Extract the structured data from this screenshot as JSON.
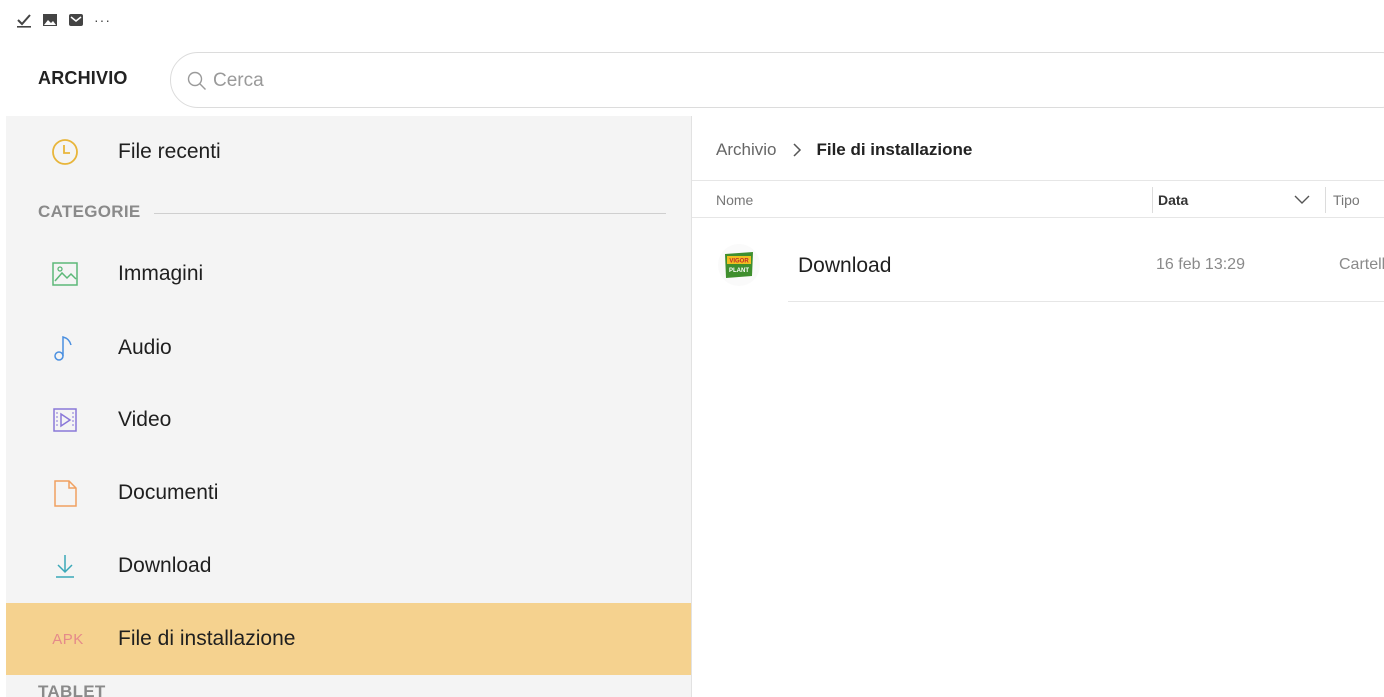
{
  "status_bar": {
    "icons": [
      "download-done-icon",
      "image-icon",
      "mail-icon"
    ],
    "more": "···"
  },
  "header": {
    "app_title": "ARCHIVIO",
    "search_placeholder": "Cerca"
  },
  "sidebar": {
    "recent": {
      "label": "File recenti",
      "icon": "clock-icon"
    },
    "category_header": "CATEGORIE",
    "items": [
      {
        "label": "Immagini",
        "icon": "image-icon"
      },
      {
        "label": "Audio",
        "icon": "music-note-icon"
      },
      {
        "label": "Video",
        "icon": "video-icon"
      },
      {
        "label": "Documenti",
        "icon": "document-icon"
      },
      {
        "label": "Download",
        "icon": "download-icon"
      },
      {
        "label": "File di installazione",
        "icon_text": "APK",
        "active": true
      }
    ],
    "next_header": "TABLET"
  },
  "main": {
    "breadcrumb": {
      "root": "Archivio",
      "current": "File di installazione"
    },
    "columns": {
      "name": "Nome",
      "date": "Data",
      "type": "Tipo"
    },
    "rows": [
      {
        "name": "Download",
        "date": "16 feb 13:29",
        "type": "Cartella",
        "thumb_text_1": "VIGOR",
        "thumb_text_2": "PLANT"
      }
    ]
  },
  "colors": {
    "accent_active": "#f5d28f",
    "clock": "#e8b53a",
    "images": "#5cb878",
    "audio": "#4a8fe0",
    "video": "#8a78d8",
    "documents": "#f0a060",
    "download": "#3aa8b8",
    "apk": "#e58a8a"
  }
}
